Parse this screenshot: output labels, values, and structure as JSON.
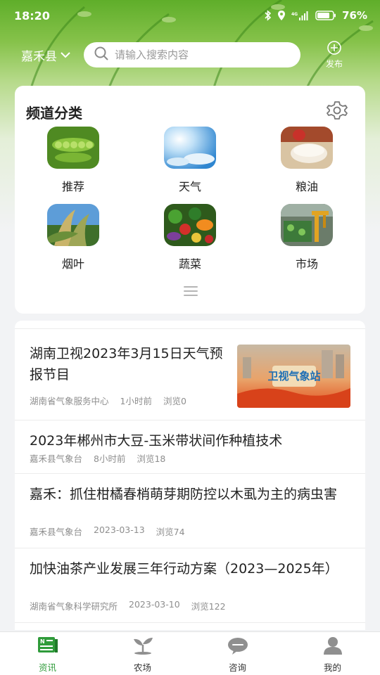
{
  "status_bar": {
    "time": "18:20",
    "battery": "76%",
    "network": "4G"
  },
  "header": {
    "county": "嘉禾县",
    "search_placeholder": "请输入搜索内容",
    "publish_label": "发布"
  },
  "channels": {
    "title": "频道分类",
    "items": [
      {
        "label": "推荐"
      },
      {
        "label": "天气"
      },
      {
        "label": "粮油"
      },
      {
        "label": "烟叶"
      },
      {
        "label": "蔬菜"
      },
      {
        "label": "市场"
      }
    ]
  },
  "news": [
    {
      "title": "湖南卫视2023年3月15日天气预报节目",
      "source": "湖南省气象服务中心",
      "time": "1小时前",
      "views": "浏览0",
      "thumb_text": "卫视气象站"
    },
    {
      "title": "2023年郴州市大豆-玉米带状间作种植技术",
      "source": "嘉禾县气象台",
      "time": "8小时前",
      "views": "浏览18"
    },
    {
      "title": "嘉禾：抓住柑橘春梢萌芽期防控以木虱为主的病虫害",
      "source": "嘉禾县气象台",
      "time": "2023-03-13",
      "views": "浏览74"
    },
    {
      "title": "加快油茶产业发展三年行动方案（2023—2025年）",
      "source": "湖南省气象科学研究所",
      "time": "2023-03-10",
      "views": "浏览122"
    }
  ],
  "bottom_nav": [
    {
      "label": "资讯",
      "active": true
    },
    {
      "label": "农场"
    },
    {
      "label": "咨询"
    },
    {
      "label": "我的"
    }
  ],
  "colors": {
    "accent": "#2f9b3a",
    "hero_green": "#6cb534"
  }
}
